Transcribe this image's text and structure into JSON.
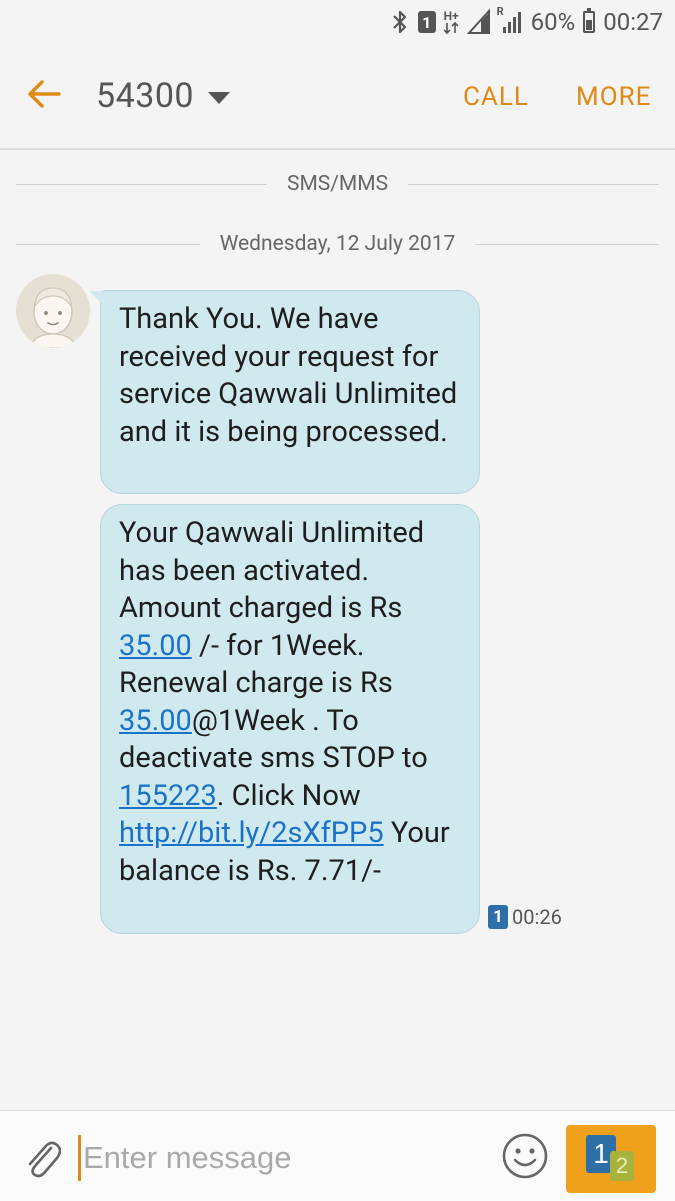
{
  "status_bar": {
    "sim_number": "1",
    "network_type": "H+",
    "roaming": "R",
    "battery_percent": "60%",
    "time": "00:27",
    "icons": [
      "bluetooth-icon",
      "sim-icon",
      "data-arrows-icon",
      "signal-icon",
      "signal-roaming-icon",
      "battery-icon"
    ]
  },
  "header": {
    "contact_name": "54300",
    "call_label": "CALL",
    "more_label": "MORE",
    "accent_color": "#e08a16"
  },
  "conversation": {
    "channel_label": "SMS/MMS",
    "date_label": "Wednesday, 12 July 2017",
    "messages": [
      {
        "text": "Thank You. We have received your request for service Qawwali Unlimited and it is being processed."
      },
      {
        "parts": {
          "p1": "Your Qawwali  Unlimited has been activated. Amount charged is Rs ",
          "link1": "35.00",
          "p2": "  /- for 1Week. Renewal charge is Rs ",
          "link2": "35.00",
          "p3": "@1Week . To deactivate sms STOP to ",
          "link3": "155223",
          "p4": ". Click Now ",
          "link4": "http://bit.ly/2sXfPP5",
          "p5": " Your balance is Rs. 7.71/-"
        },
        "sim": "1",
        "time": "00:26"
      }
    ],
    "bubble_color": "#cfe9ee",
    "link_color": "#1a73c8"
  },
  "composer": {
    "placeholder": "Enter message",
    "value": "",
    "send_sim_primary": "1",
    "send_sim_secondary": "2",
    "send_color": "#f0a11c"
  }
}
